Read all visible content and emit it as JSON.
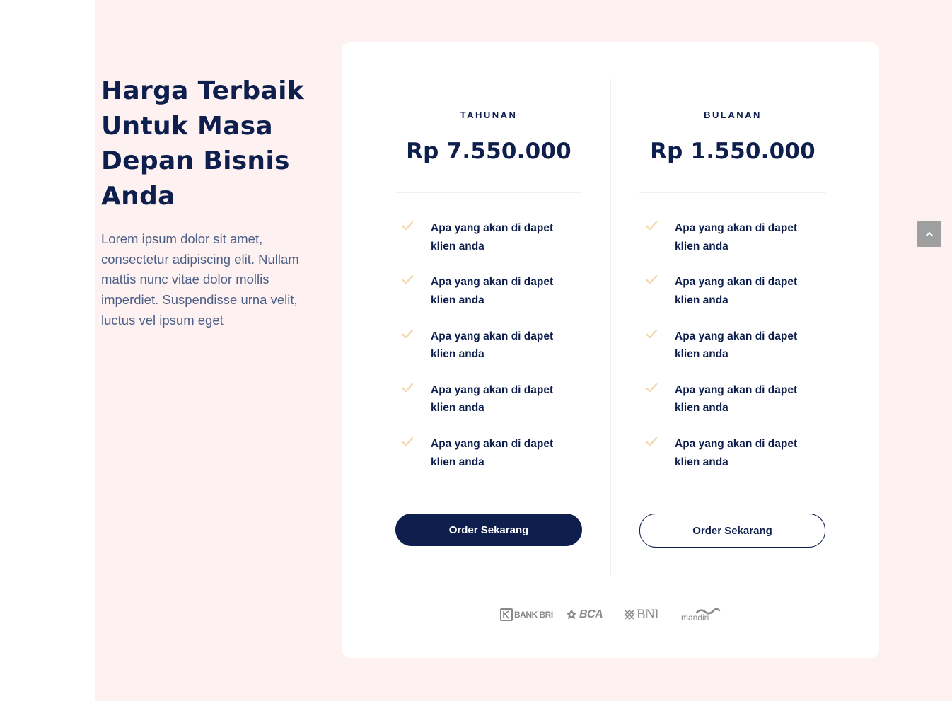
{
  "intro": {
    "heading": "Harga Terbaik Untuk Masa Depan Bisnis Anda",
    "description": "Lorem ipsum dolor sit amet, consectetur adipiscing elit. Nullam mattis nunc vitae dolor mollis imperdiet. Suspendisse urna velit, luctus vel ipsum eget"
  },
  "plans": [
    {
      "name": "TAHUNAN",
      "price": "Rp 7.550.000",
      "features": [
        "Apa yang akan di dapet klien anda",
        "Apa yang akan di dapet klien anda",
        "Apa yang akan di dapet klien anda",
        "Apa yang akan di dapet klien anda",
        "Apa yang akan di dapet klien anda"
      ],
      "button_label": "Order Sekarang"
    },
    {
      "name": "BULANAN",
      "price": "Rp 1.550.000",
      "features": [
        "Apa yang akan di dapet klien anda",
        "Apa yang akan di dapet klien anda",
        "Apa yang akan di dapet klien anda",
        "Apa yang akan di dapet klien anda",
        "Apa yang akan di dapet klien anda"
      ],
      "button_label": "Order Sekarang"
    }
  ],
  "banks": {
    "bri": "BANK BRI",
    "bca": "BCA",
    "bni": "BNI",
    "mandiri": "mandiri"
  },
  "icons": {
    "feature": "check-icon",
    "scroll": "chevron-up-icon"
  },
  "colors": {
    "primary": "#0e1f4d",
    "check": "#f2d7ad",
    "background": "#fdf2f1",
    "body_text": "#4d5f86"
  }
}
